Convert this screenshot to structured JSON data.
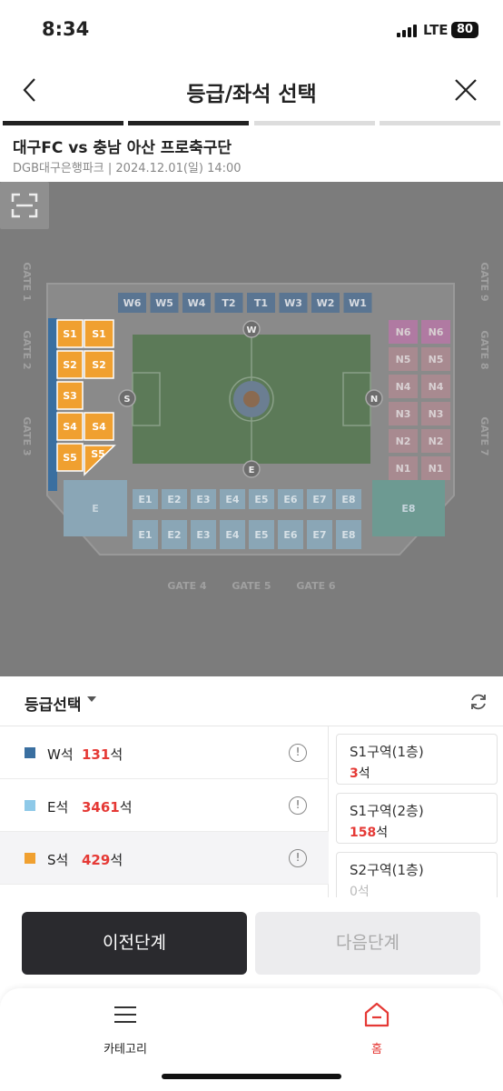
{
  "status_bar": {
    "time": "8:34",
    "network": "LTE",
    "battery": "80"
  },
  "header": {
    "title": "등급/좌석 선택",
    "back_icon": "chevron-left-icon",
    "close_icon": "close-icon"
  },
  "progress": {
    "steps": 4,
    "completed": 2
  },
  "event": {
    "title": "대구FC vs 충남 아산 프로축구단",
    "subtitle": "DGB대구은행파크 | 2024.12.01(일) 14:00"
  },
  "map": {
    "gates": [
      "GATE 1",
      "GATE 2",
      "GATE 3",
      "GATE 4",
      "GATE 5",
      "GATE 6",
      "GATE 7",
      "GATE 8",
      "GATE 9"
    ],
    "west_sections": [
      "W6",
      "W5",
      "W4",
      "T2",
      "T1",
      "W3",
      "W2",
      "W1"
    ],
    "south_sections_left": [
      "S1",
      "S2",
      "S3",
      "S4",
      "S5"
    ],
    "south_sections_right": [
      "S1",
      "S2",
      "S4",
      "S5"
    ],
    "north_sections": [
      "N6",
      "N5",
      "N4",
      "N3",
      "N2",
      "N1"
    ],
    "east_upper": [
      "E1",
      "E2",
      "E3",
      "E4",
      "E5",
      "E6",
      "E7",
      "E8"
    ],
    "east_lower": [
      "E1",
      "E2",
      "E3",
      "E4",
      "E5",
      "E6",
      "E7",
      "E8"
    ],
    "stand_markers": {
      "west": "W",
      "east": "E",
      "south": "S",
      "north": "N"
    },
    "colors": {
      "west": "#3a6fa0",
      "east": "#8ec9e8",
      "south": "#f0a030",
      "north": "#e2a0b0",
      "field": "#5fa85a"
    }
  },
  "grade_select": {
    "label": "등급선택",
    "refresh_icon": "refresh-icon"
  },
  "grades": [
    {
      "name": "W석",
      "count": "131",
      "unit": "석",
      "color": "#3a6fa0"
    },
    {
      "name": "E석",
      "count": "3461",
      "unit": "석",
      "color": "#8ec9e8"
    },
    {
      "name": "S석",
      "count": "429",
      "unit": "석",
      "color": "#f0a030"
    }
  ],
  "areas": [
    {
      "name": "S1구역(1층)",
      "count": "3",
      "unit": "석"
    },
    {
      "name": "S1구역(2층)",
      "count": "158",
      "unit": "석"
    },
    {
      "name": "S2구역(1층)",
      "count": "0",
      "unit": "석"
    }
  ],
  "buttons": {
    "prev": "이전단계",
    "next": "다음단계"
  },
  "tabbar": {
    "category": "카테고리",
    "home": "홈"
  }
}
